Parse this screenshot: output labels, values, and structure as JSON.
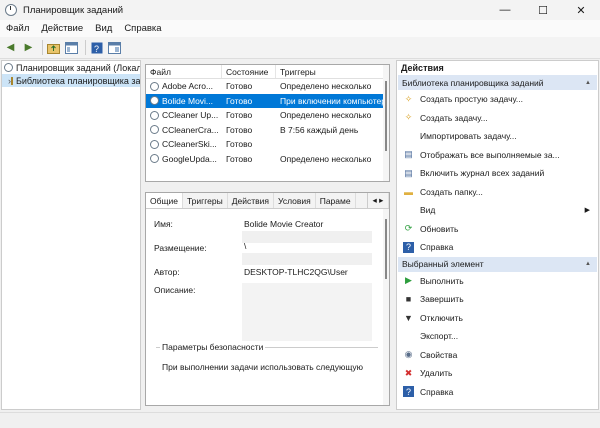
{
  "window": {
    "title": "Планировщик заданий",
    "minimize": "—",
    "maximize": "☐",
    "close": "✕"
  },
  "menu": [
    "Файл",
    "Действие",
    "Вид",
    "Справка"
  ],
  "tree": [
    {
      "label": "Планировщик заданий (Локальный)",
      "expander": ""
    },
    {
      "label": "Библиотека планировщика заданий",
      "expander": "›"
    }
  ],
  "tasks": {
    "columns": [
      "Файл",
      "Состояние",
      "Триггеры"
    ],
    "rows": [
      {
        "name": "Adobe Acro...",
        "state": "Готово",
        "trigger": "Определено несколько"
      },
      {
        "name": "Bolide Movi...",
        "state": "Готово",
        "trigger": "При включении компьютера"
      },
      {
        "name": "CCleaner Up...",
        "state": "Готово",
        "trigger": "Определено несколько"
      },
      {
        "name": "CCleanerCra...",
        "state": "Готово",
        "trigger": "В 7:56 каждый день"
      },
      {
        "name": "CCleanerSki...",
        "state": "Готово",
        "trigger": ""
      },
      {
        "name": "GoogleUpda...",
        "state": "Готово",
        "trigger": "Определено несколько"
      }
    ]
  },
  "detail": {
    "tabs": [
      "Общие",
      "Триггеры",
      "Действия",
      "Условия",
      "Параме"
    ],
    "arrows": "◂ ▸",
    "name_label": "Имя:",
    "name_value": "Bolide Movie Creator",
    "location_label": "Размещение:",
    "location_value": "\\",
    "author_label": "Автор:",
    "author_value": "DESKTOP-TLHC2QG\\User",
    "description_label": "Описание:",
    "security_title": "Параметры безопасности",
    "security_text": "При выполнении задачи использовать следующую"
  },
  "actions": {
    "header": "Действия",
    "group1": "Библиотека планировщика заданий",
    "items1": [
      {
        "label": "Создать простую задачу...",
        "icon": "✧"
      },
      {
        "label": "Создать задачу...",
        "icon": "✧"
      },
      {
        "label": "Импортировать задачу...",
        "icon": ""
      },
      {
        "label": "Отображать все выполняемые за...",
        "icon": "▤"
      },
      {
        "label": "Включить журнал всех заданий",
        "icon": "▤"
      },
      {
        "label": "Создать папку...",
        "icon": "▬"
      },
      {
        "label": "Вид",
        "icon": ""
      },
      {
        "label": "Обновить",
        "icon": "⟳"
      },
      {
        "label": "Справка",
        "icon": "?"
      }
    ],
    "group2": "Выбранный элемент",
    "items2": [
      {
        "label": "Выполнить",
        "icon": "▶"
      },
      {
        "label": "Завершить",
        "icon": "■"
      },
      {
        "label": "Отключить",
        "icon": "▼"
      },
      {
        "label": "Экспорт...",
        "icon": ""
      },
      {
        "label": "Свойства",
        "icon": "◉"
      },
      {
        "label": "Удалить",
        "icon": "✖"
      },
      {
        "label": "Справка",
        "icon": "?"
      }
    ]
  },
  "colors": {
    "selection": "#0078d7",
    "group_header": "#dce6f4",
    "delete_icon": "#d32f2f",
    "run_icon": "#2e9e3e"
  }
}
